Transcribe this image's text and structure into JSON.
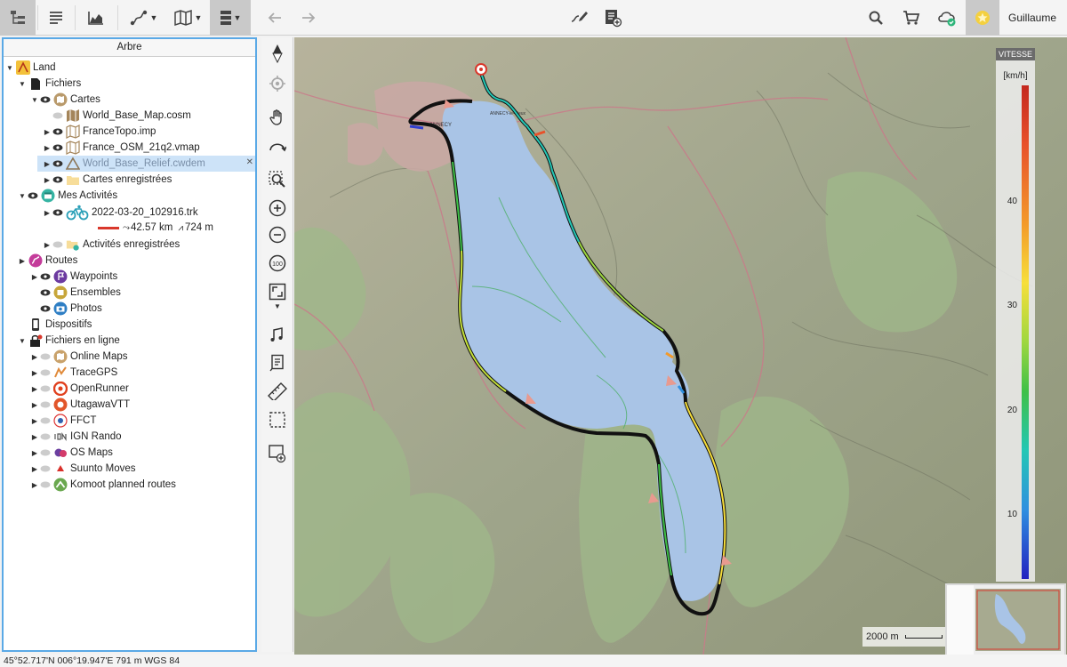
{
  "toolbar": {
    "user_name": "Guillaume"
  },
  "tree": {
    "header": "Arbre",
    "items": [
      {
        "label": "Land"
      },
      {
        "label": "Fichiers"
      },
      {
        "label": "Cartes"
      },
      {
        "label": "World_Base_Map.cosm"
      },
      {
        "label": "FranceTopo.imp"
      },
      {
        "label": "France_OSM_21q2.vmap"
      },
      {
        "label": "World_Base_Relief.cwdem"
      },
      {
        "label": "Cartes enregistrées"
      },
      {
        "label": "Mes Activités"
      },
      {
        "label": "2022-03-20_102916.trk"
      },
      {
        "label": "Activités enregistrées"
      },
      {
        "label": "Routes"
      },
      {
        "label": "Waypoints"
      },
      {
        "label": "Ensembles"
      },
      {
        "label": "Photos"
      },
      {
        "label": "Dispositifs"
      },
      {
        "label": "Fichiers en ligne"
      },
      {
        "label": "Online Maps"
      },
      {
        "label": "TraceGPS"
      },
      {
        "label": "OpenRunner"
      },
      {
        "label": "UtagawaVTT"
      },
      {
        "label": "FFCT"
      },
      {
        "label": "IGN Rando"
      },
      {
        "label": "OS Maps"
      },
      {
        "label": "Suunto Moves"
      },
      {
        "label": "Komoot planned routes"
      }
    ],
    "track_distance": "42.57 km",
    "track_elevation": "724 m"
  },
  "legend": {
    "title": "VITESSE",
    "unit": "[km/h]",
    "ticks": [
      "40",
      "30",
      "20",
      "10"
    ]
  },
  "map": {
    "scale_label": "2000 m",
    "labels": [
      "ANNECY",
      "ANNECY-le-Vieux"
    ]
  },
  "status": {
    "coordinates": "45°52.717'N 006°19.947'E  791 m  WGS 84"
  },
  "colors": {
    "selection_border": "#5aa9e6",
    "selected_row": "#cde3f8",
    "lake": "#a9c4e6",
    "track": "#111111"
  }
}
